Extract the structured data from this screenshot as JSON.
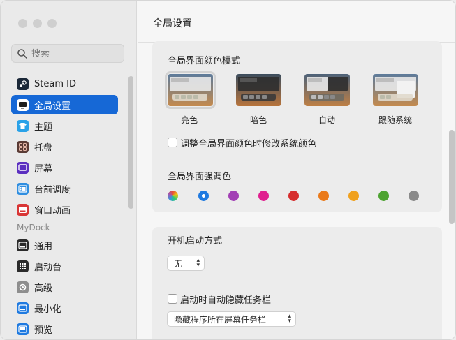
{
  "sidebar": {
    "search_placeholder": "搜索",
    "section_header": "MyDock",
    "items": [
      {
        "label": "Steam ID",
        "icon": "steam-icon",
        "color": "#1b2838"
      },
      {
        "label": "全局设置",
        "icon": "display-icon",
        "color": "#1668d6"
      },
      {
        "label": "主题",
        "icon": "tshirt-icon",
        "color": "#2aa2e8"
      },
      {
        "label": "托盘",
        "icon": "grid-icon",
        "color": "#5a3b35"
      },
      {
        "label": "屏幕",
        "icon": "screen-icon",
        "color": "#5b2fc0"
      },
      {
        "label": "台前调度",
        "icon": "stage-manager-icon",
        "color": "#2f8ee0"
      },
      {
        "label": "窗口动画",
        "icon": "window-animation-icon",
        "color": "#d93636"
      },
      {
        "label": "通用",
        "icon": "general-icon",
        "color": "#2b2b2b"
      },
      {
        "label": "启动台",
        "icon": "launchpad-icon",
        "color": "#2b2b2b"
      },
      {
        "label": "高级",
        "icon": "advanced-icon",
        "color": "#8e8e8e"
      },
      {
        "label": "最小化",
        "icon": "minimize-icon",
        "color": "#1f7ae0"
      },
      {
        "label": "预览",
        "icon": "preview-icon",
        "color": "#1f7ae0"
      }
    ]
  },
  "main": {
    "title": "全局设置",
    "appearance": {
      "title": "全局界面颜色模式",
      "modes": [
        {
          "label": "亮色",
          "selected": true
        },
        {
          "label": "暗色",
          "selected": false
        },
        {
          "label": "自动",
          "selected": false
        },
        {
          "label": "跟随系统",
          "selected": false
        }
      ],
      "sync_checkbox_label": "调整全局界面颜色时修改系统颜色"
    },
    "accent": {
      "title": "全局界面强调色",
      "colors": [
        "multicolor",
        "#1f7ae0",
        "#a23fb5",
        "#e01f8f",
        "#d62d2d",
        "#ea7a1a",
        "#f0a11e",
        "#4ea332",
        "#8a8a8a"
      ]
    },
    "startup": {
      "title": "开机启动方式",
      "mode_value": "无",
      "autohide_label": "启动时自动隐藏任务栏",
      "hide_mode_value": "隐藏程序所在屏幕任务栏"
    }
  }
}
